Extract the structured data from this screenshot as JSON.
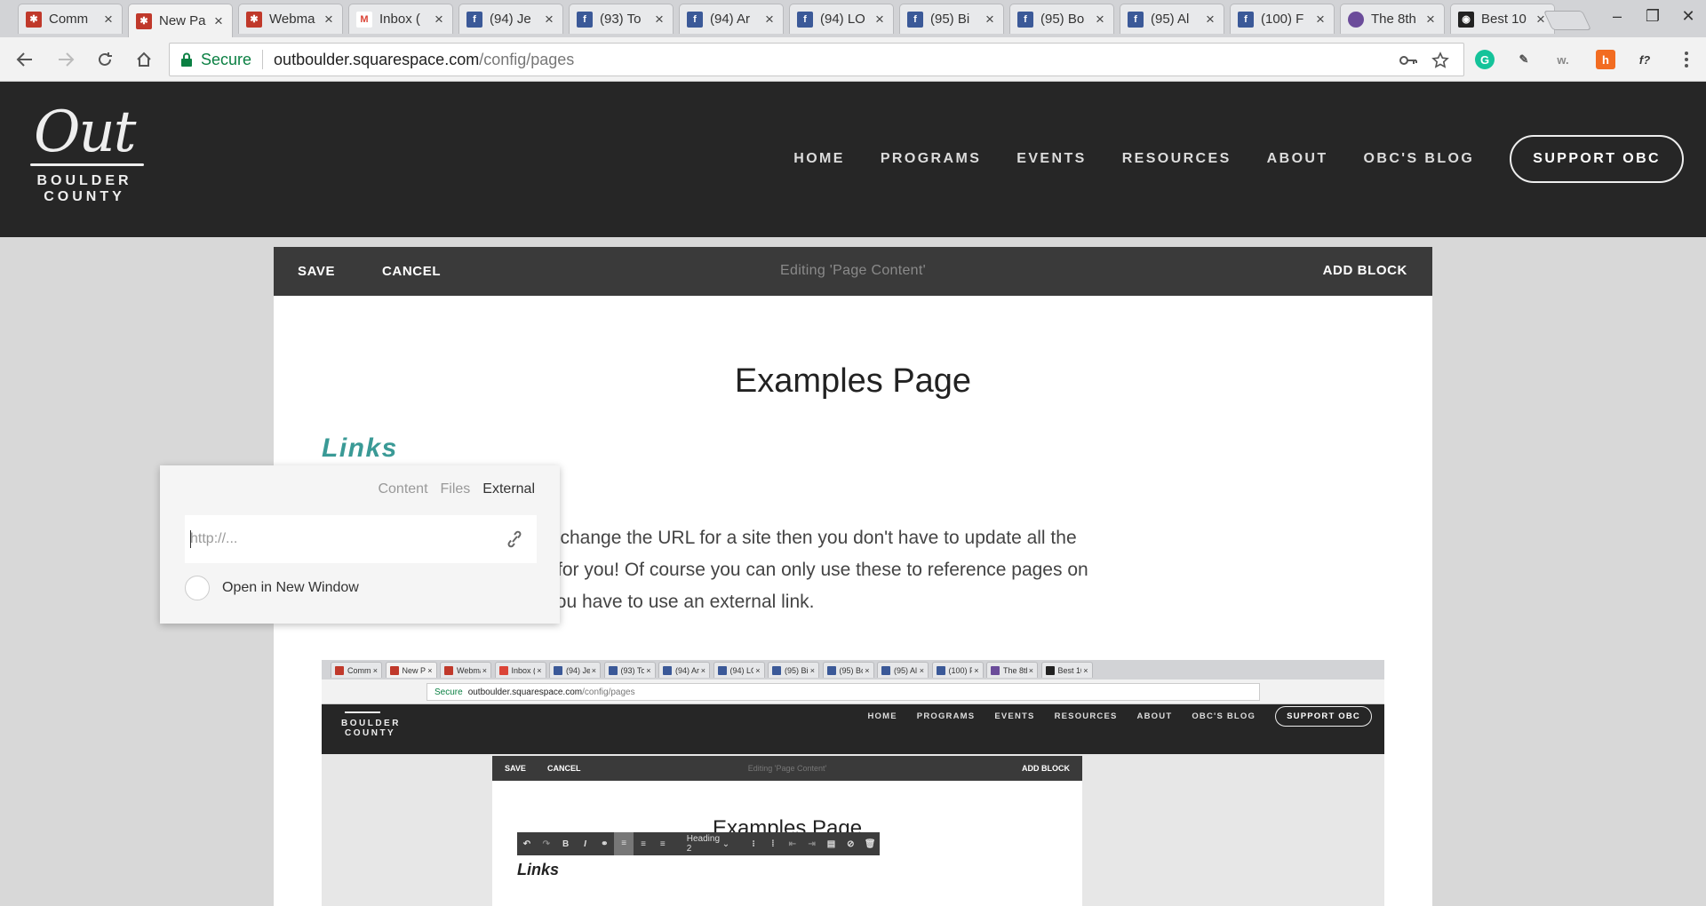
{
  "browser": {
    "tabs": [
      {
        "label": "Comm",
        "favicon": "out-logo-icon",
        "color": "#c0392b"
      },
      {
        "label": "New Pa",
        "favicon": "out-logo-icon",
        "color": "#c0392b",
        "active": true
      },
      {
        "label": "Webma",
        "favicon": "out-logo-icon",
        "color": "#c0392b"
      },
      {
        "label": "Inbox (",
        "favicon": "gmail-icon",
        "color": "#db4437"
      },
      {
        "label": "(94) Je",
        "favicon": "facebook-icon",
        "color": "#3b5998"
      },
      {
        "label": "(93) To",
        "favicon": "facebook-icon",
        "color": "#3b5998"
      },
      {
        "label": "(94) Ar",
        "favicon": "facebook-icon",
        "color": "#3b5998"
      },
      {
        "label": "(94) LO",
        "favicon": "facebook-icon",
        "color": "#3b5998"
      },
      {
        "label": "(95) Bi",
        "favicon": "facebook-icon",
        "color": "#3b5998"
      },
      {
        "label": "(95) Bo",
        "favicon": "facebook-icon",
        "color": "#3b5998"
      },
      {
        "label": "(95) Al",
        "favicon": "facebook-icon",
        "color": "#3b5998"
      },
      {
        "label": "(100) F",
        "favicon": "facebook-icon",
        "color": "#3b5998"
      },
      {
        "label": "The 8th",
        "favicon": "feather-icon",
        "color": "#6b4c9a"
      },
      {
        "label": "Best 10",
        "favicon": "camera-icon",
        "color": "#222222"
      }
    ],
    "omnibox": {
      "secure_label": "Secure",
      "url_host": "outboulder.squarespace.com",
      "url_path": "/config/pages"
    },
    "extensions": [
      {
        "name": "grammarly-icon",
        "glyph": "G",
        "color": "#15c39a"
      },
      {
        "name": "evernote-icon",
        "glyph": "✎",
        "color": "#555555"
      },
      {
        "name": "wappalyzer-icon",
        "glyph": "w.",
        "color": "#888888"
      },
      {
        "name": "honey-icon",
        "glyph": "h",
        "color": "#f26c21"
      },
      {
        "name": "font-finder-icon",
        "glyph": "f?",
        "color": "#333333"
      }
    ]
  },
  "site": {
    "logo": {
      "out": "Out",
      "line1": "BOULDER",
      "line2": "COUNTY"
    },
    "nav": [
      "HOME",
      "PROGRAMS",
      "EVENTS",
      "RESOURCES",
      "ABOUT",
      "OBC'S BLOG"
    ],
    "support_label": "SUPPORT OBC"
  },
  "editor": {
    "save_label": "SAVE",
    "cancel_label": "CANCEL",
    "title": "Editing 'Page Content'",
    "add_block_label": "ADD BLOCK"
  },
  "page": {
    "title": "Examples Page",
    "links_heading": "Links",
    "body_lines": [
      "the best because if you ever change the URL for a site then you don't have to update all the",
      "ed that URL, the site does it for you! Of course you can only use these to reference pages on",
      "nother site (like Facebook) you have to use an external link."
    ]
  },
  "link_popup": {
    "tabs": [
      "Content",
      "Files",
      "External"
    ],
    "active_tab": "External",
    "url_placeholder": "http://...",
    "new_window_label": "Open in New Window"
  },
  "embedded_screenshot": {
    "tabs": [
      "Comm",
      "New Pa",
      "Webma",
      "Inbox (",
      "(94) Je",
      "(93) To",
      "(94) Ar",
      "(94) LO",
      "(95) Bi",
      "(95) Bo",
      "(95) Al",
      "(100) F",
      "The 8th",
      "Best 10"
    ],
    "secure_label": "Secure",
    "url_host": "outboulder.squarespace.com",
    "url_path": "/config/pages",
    "logo_line1": "BOULDER",
    "logo_line2": "COUNTY",
    "nav": [
      "HOME",
      "PROGRAMS",
      "EVENTS",
      "RESOURCES",
      "ABOUT",
      "OBC'S BLOG"
    ],
    "support_label": "SUPPORT OBC",
    "save_label": "SAVE",
    "cancel_label": "CANCEL",
    "edit_title": "Editing 'Page Content'",
    "add_block_label": "ADD BLOCK",
    "page_title": "Examples Page",
    "format_style": "Heading 2",
    "links_heading": "Links"
  }
}
